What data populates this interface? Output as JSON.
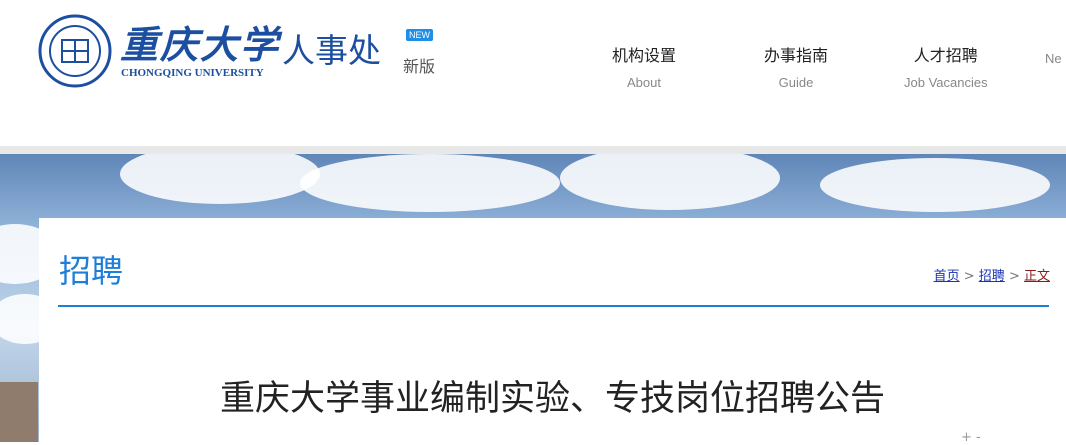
{
  "header": {
    "logo_cn": "重庆大学",
    "logo_en": "CHONGQING UNIVERSITY",
    "dept": "人事处",
    "badge": "NEW",
    "new_text": "新版"
  },
  "nav": [
    {
      "cn": "机构设置",
      "en": "About"
    },
    {
      "cn": "办事指南",
      "en": "Guide"
    },
    {
      "cn": "人才招聘",
      "en": "Job Vacancies"
    },
    {
      "cn": "",
      "en": "Ne"
    }
  ],
  "section": {
    "title": "招聘"
  },
  "breadcrumb": {
    "home": "首页",
    "sep": ">",
    "section": "招聘",
    "current": "正文"
  },
  "article": {
    "title": "重庆大学事业编制实验、专技岗位招聘公告"
  },
  "colors": {
    "primary": "#1e7fd8",
    "logo": "#1c4fa0"
  }
}
